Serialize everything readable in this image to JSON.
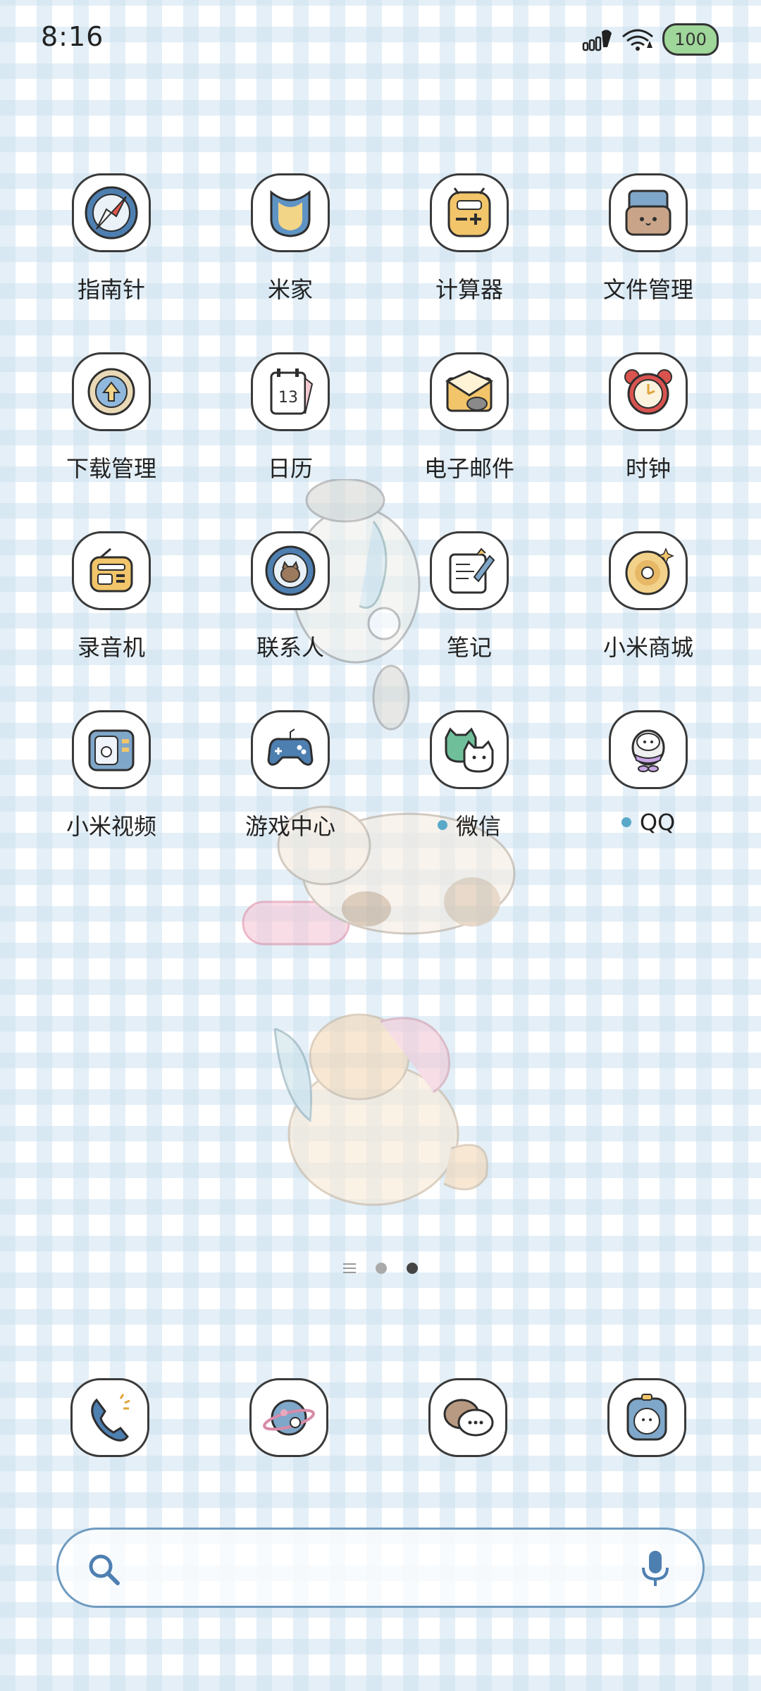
{
  "status_bar": {
    "time": "8:16",
    "battery": "100",
    "battery_color": "#9fd69a"
  },
  "apps": [
    {
      "label": "指南针",
      "icon": "compass-icon",
      "badge": false
    },
    {
      "label": "米家",
      "icon": "mijia-icon",
      "badge": false
    },
    {
      "label": "计算器",
      "icon": "calculator-icon",
      "badge": false
    },
    {
      "label": "文件管理",
      "icon": "file-manager-icon",
      "badge": false
    },
    {
      "label": "下载管理",
      "icon": "download-icon",
      "badge": false
    },
    {
      "label": "日历",
      "icon": "calendar-icon",
      "badge": false,
      "date": "13"
    },
    {
      "label": "电子邮件",
      "icon": "email-icon",
      "badge": false
    },
    {
      "label": "时钟",
      "icon": "clock-icon",
      "badge": false
    },
    {
      "label": "录音机",
      "icon": "recorder-icon",
      "badge": false
    },
    {
      "label": "联系人",
      "icon": "contacts-icon",
      "badge": false
    },
    {
      "label": "笔记",
      "icon": "notes-icon",
      "badge": false
    },
    {
      "label": "小米商城",
      "icon": "mi-store-icon",
      "badge": false
    },
    {
      "label": "小米视频",
      "icon": "mi-video-icon",
      "badge": false
    },
    {
      "label": "游戏中心",
      "icon": "game-center-icon",
      "badge": false
    },
    {
      "label": "微信",
      "icon": "wechat-icon",
      "badge": true
    },
    {
      "label": "QQ",
      "icon": "qq-icon",
      "badge": true
    }
  ],
  "dock": [
    {
      "icon": "phone-icon"
    },
    {
      "icon": "browser-icon"
    },
    {
      "icon": "messages-icon"
    },
    {
      "icon": "camera-icon"
    }
  ],
  "page_indicator": {
    "pages": 2,
    "active": 2
  },
  "search": {
    "placeholder": ""
  },
  "colors": {
    "grid_blue": "#cde2f0",
    "badge": "#5aa9c9",
    "search_border": "#6f9bc0"
  }
}
